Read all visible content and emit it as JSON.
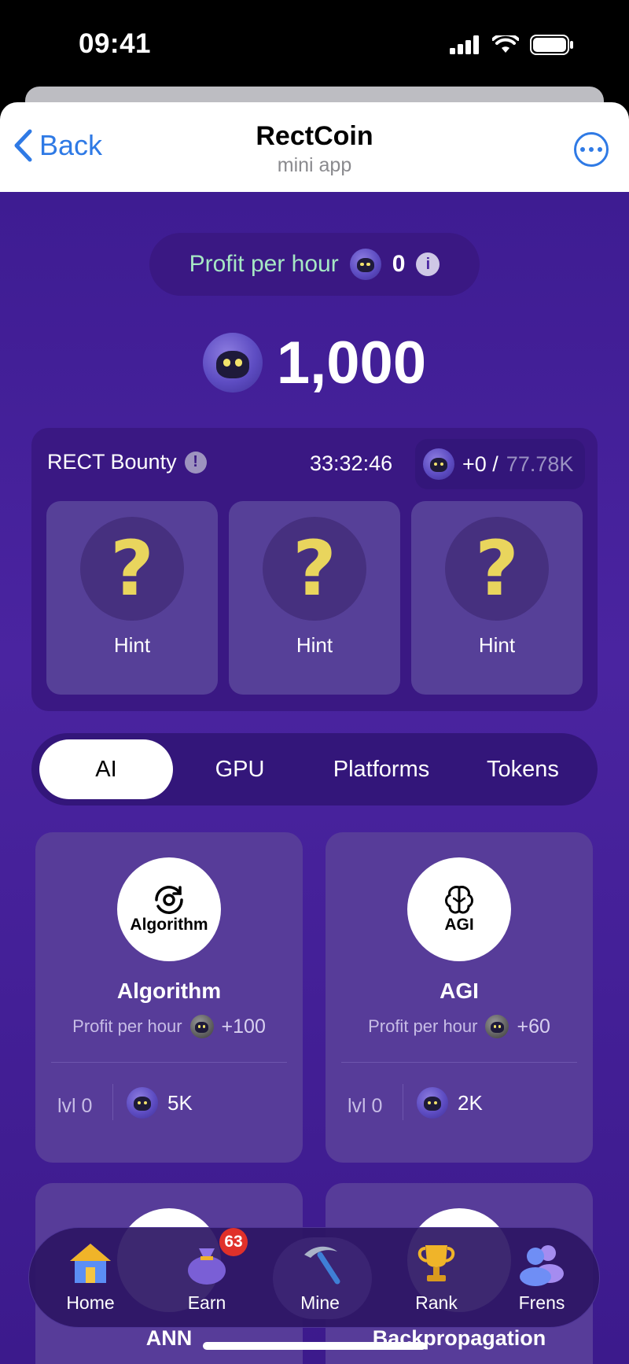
{
  "status_bar": {
    "time": "09:41"
  },
  "header": {
    "back_label": "Back",
    "title": "RectCoin",
    "subtitle": "mini app"
  },
  "profit_per_hour": {
    "label": "Profit per hour",
    "value": "0"
  },
  "balance": {
    "value": "1,000"
  },
  "bounty": {
    "title": "RECT Bounty",
    "timer": "33:32:46",
    "reward_current": "+0 /",
    "reward_total": "77.78K",
    "hints": [
      {
        "label": "Hint"
      },
      {
        "label": "Hint"
      },
      {
        "label": "Hint"
      }
    ]
  },
  "tabs": [
    {
      "label": "AI",
      "active": true
    },
    {
      "label": "GPU",
      "active": false
    },
    {
      "label": "Platforms",
      "active": false
    },
    {
      "label": "Tokens",
      "active": false
    }
  ],
  "cards": [
    {
      "name": "Algorithm",
      "icon_caption": "Algorithm",
      "icon": "refresh-eye-icon",
      "profit_label": "Profit per hour",
      "profit": "+100",
      "level": "lvl 0",
      "cost": "5K"
    },
    {
      "name": "AGI",
      "icon_caption": "AGI",
      "icon": "brain-icon",
      "profit_label": "Profit per hour",
      "profit": "+60",
      "level": "lvl 0",
      "cost": "2K"
    },
    {
      "name": "ANN"
    },
    {
      "name": "Backpropagation"
    }
  ],
  "nav": [
    {
      "label": "Home",
      "icon": "house-icon"
    },
    {
      "label": "Earn",
      "icon": "money-bag-icon",
      "badge": "63"
    },
    {
      "label": "Mine",
      "icon": "pickaxe-icon",
      "active": true
    },
    {
      "label": "Rank",
      "icon": "trophy-icon"
    },
    {
      "label": "Frens",
      "icon": "people-icon"
    }
  ]
}
